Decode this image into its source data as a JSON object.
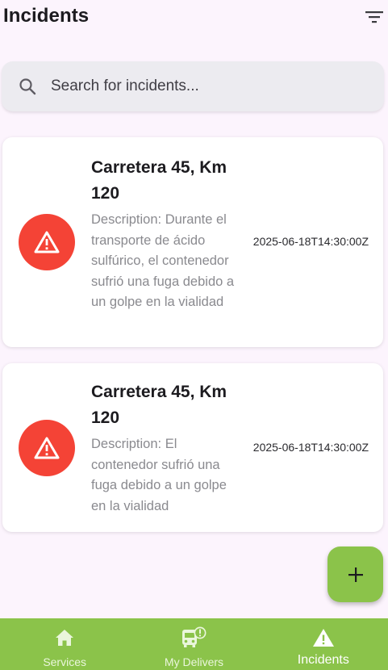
{
  "header": {
    "title": "Incidents",
    "filter_icon": "filter-icon"
  },
  "search": {
    "placeholder": "Search for incidents...",
    "value": "",
    "icon": "search-icon"
  },
  "incidents": [
    {
      "title": "Carretera 45, Km 120",
      "description": "Description: Durante el transporte de ácido sulfúrico, el contenedor sufrió una fuga debido a un golpe en la vialidad",
      "date": "2025-06-18T14:30:00Z",
      "icon": "warning-icon"
    },
    {
      "title": "Carretera 45, Km 120",
      "description": "Description: El contenedor sufrió una fuga debido a un golpe en la vialidad",
      "date": "2025-06-18T14:30:00Z",
      "icon": "warning-icon"
    }
  ],
  "fab": {
    "icon": "plus-icon",
    "symbol": "+"
  },
  "bottom_nav": {
    "items": [
      {
        "label": "Services",
        "icon": "home-icon",
        "active": false
      },
      {
        "label": "My Delivers",
        "icon": "bus-alert-icon",
        "active": false
      },
      {
        "label": "Incidents",
        "icon": "warning-icon",
        "active": true
      }
    ]
  },
  "colors": {
    "background": "#fcf4fd",
    "accent_green": "#8bc34a",
    "alert_red": "#f44336",
    "card_bg": "#ffffff"
  }
}
